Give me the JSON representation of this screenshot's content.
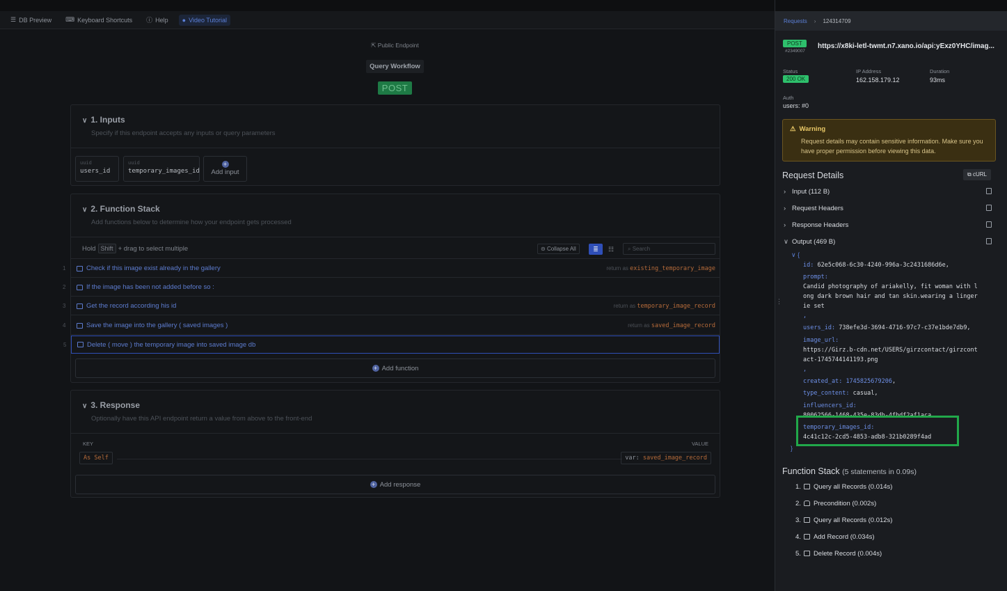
{
  "toolbar": {
    "items": [
      {
        "label": "DB Preview",
        "icon": "database-icon"
      },
      {
        "label": "Keyboard Shortcuts",
        "icon": "keyboard-icon"
      },
      {
        "label": "Help",
        "icon": "help-icon"
      },
      {
        "label": "Video Tutorial",
        "icon": "play-icon",
        "active": true
      }
    ]
  },
  "endpoint": {
    "public_label": "Public Endpoint",
    "workflow_label": "Query Workflow",
    "method": "POST"
  },
  "inputs": {
    "title": "1. Inputs",
    "subtitle": "Specify if this endpoint accepts any inputs or query parameters",
    "fields": [
      {
        "type": "uuid",
        "name": "users_id"
      },
      {
        "type": "uuid",
        "name": "temporary_images_id"
      }
    ],
    "add_label": "Add input"
  },
  "function_stack": {
    "title": "2. Function Stack",
    "subtitle": "Add functions below to determine how your endpoint gets processed",
    "hint_hold": "Hold",
    "hint_key": "Shift",
    "hint_rest": "+ drag to select multiple",
    "collapse_label": "Collapse All",
    "search_placeholder": "Search",
    "rows": [
      {
        "num": "1",
        "label": "Check if this image exist already in the gallery",
        "return_prefix": "return as",
        "return_var": "existing_temporary_image"
      },
      {
        "num": "2",
        "label": "If the image has been not added before so :",
        "return_prefix": "",
        "return_var": ""
      },
      {
        "num": "3",
        "label": "Get the record according his id",
        "return_prefix": "return as",
        "return_var": "temporary_image_record"
      },
      {
        "num": "4",
        "label": "Save the image into the gallery ( saved images )",
        "return_prefix": "return as",
        "return_var": "saved_image_record"
      },
      {
        "num": "5",
        "label": "Delete ( move ) the temporary image into saved image db",
        "return_prefix": "",
        "return_var": ""
      }
    ],
    "add_label": "Add function"
  },
  "response": {
    "title": "3. Response",
    "subtitle": "Optionally have this API endpoint return a value from above to the front-end",
    "key_header": "KEY",
    "value_header": "VALUE",
    "key_value": "As Self",
    "value_prefix": "var:",
    "value_var": "saved_image_record",
    "add_label": "Add response"
  },
  "panel": {
    "breadcrumb_root": "Requests",
    "breadcrumb_id": "124314709",
    "method": "POST",
    "request_id": "#2349007",
    "url": "https://x8ki-letl-twmt.n7.xano.io/api:yExz0YHC/imag...",
    "status_label": "Status",
    "status_value": "200 OK",
    "ip_label": "IP Address",
    "ip_value": "162.158.179.12",
    "duration_label": "Duration",
    "duration_value": "93ms",
    "auth_label": "Auth",
    "auth_value": "users: #0",
    "warning_title": "Warning",
    "warning_text": "Request details may contain sensitive information. Make sure you have proper permission before viewing this data.",
    "details_title": "Request Details",
    "curl_label": "cURL",
    "sections": [
      {
        "label": "Input (112 B)",
        "open": false
      },
      {
        "label": "Request Headers",
        "open": false
      },
      {
        "label": "Response Headers",
        "open": false
      },
      {
        "label": "Output (469 B)",
        "open": true
      }
    ],
    "output": {
      "id_key": "id",
      "id_val": "62e5c068-6c30-4240-996a-3c2431686d6e,",
      "prompt_key": "prompt",
      "prompt_line1": "Candid photography of ariakelly, fit woman with l",
      "prompt_line2": "ong dark brown hair and tan skin.wearing a linger",
      "prompt_line3": "ie set",
      "users_id_key": "users_id",
      "users_id_val": "738efe3d-3694-4716-97c7-c37e1bde7db9,",
      "image_url_key": "image_url",
      "image_url_line1": "https://Girz.b-cdn.net/USERS/girzcontact/girzcont",
      "image_url_line2": "act-1745744141193.png",
      "created_at_key": "created_at",
      "created_at_val": "1745825679206",
      "type_content_key": "type_content",
      "type_content_val": "casual,",
      "influencers_id_key": "influencers_id",
      "influencers_id_val": "80062566-1468-435e-83db-4fbdf2af1aca",
      "temporary_images_id_key": "temporary_images_id",
      "temporary_images_id_val": "4c41c12c-2cd5-4853-adb8-321b0289f4ad"
    },
    "fs_title": "Function Stack",
    "fs_summary": "(5 statements in 0.09s)",
    "fs_items": [
      {
        "label": "1.",
        "text": "Query all Records (0.014s)",
        "icon": "table-icon"
      },
      {
        "label": "2.",
        "text": "Precondition (0.002s)",
        "icon": "lock-icon"
      },
      {
        "label": "3.",
        "text": "Query all Records (0.012s)",
        "icon": "table-icon"
      },
      {
        "label": "4.",
        "text": "Add Record (0.034s)",
        "icon": "table-icon"
      },
      {
        "label": "5.",
        "text": "Delete Record (0.004s)",
        "icon": "table-icon"
      }
    ]
  },
  "colors": {
    "accent": "#5b7fd6",
    "success": "#2ec06c",
    "highlight": "#21a84a",
    "warning": "#e8c766"
  }
}
